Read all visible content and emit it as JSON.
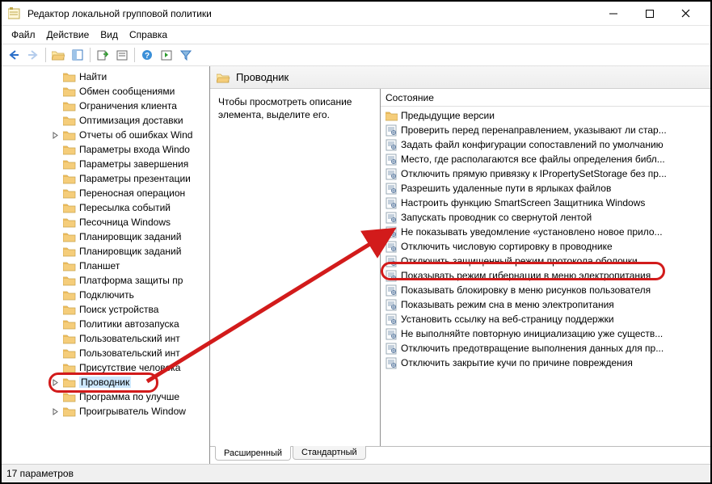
{
  "window": {
    "title": "Редактор локальной групповой политики"
  },
  "menu": {
    "file": "Файл",
    "action": "Действие",
    "view": "Вид",
    "help": "Справка"
  },
  "tree": {
    "items": [
      {
        "label": "Найти",
        "expand": ""
      },
      {
        "label": "Обмен сообщениями",
        "expand": ""
      },
      {
        "label": "Ограничения клиента",
        "expand": ""
      },
      {
        "label": "Оптимизация доставки",
        "expand": ""
      },
      {
        "label": "Отчеты об ошибках Wind",
        "expand": ">"
      },
      {
        "label": "Параметры входа Windo",
        "expand": ""
      },
      {
        "label": "Параметры завершения",
        "expand": ""
      },
      {
        "label": "Параметры презентации",
        "expand": ""
      },
      {
        "label": "Переносная операцион",
        "expand": ""
      },
      {
        "label": "Пересылка событий",
        "expand": ""
      },
      {
        "label": "Песочница Windows",
        "expand": ""
      },
      {
        "label": "Планировщик заданий",
        "expand": ""
      },
      {
        "label": "Планировщик заданий",
        "expand": ""
      },
      {
        "label": "Планшет",
        "expand": ""
      },
      {
        "label": "Платформа защиты пр",
        "expand": ""
      },
      {
        "label": "Подключить",
        "expand": ""
      },
      {
        "label": "Поиск устройства",
        "expand": ""
      },
      {
        "label": "Политики автозапуска",
        "expand": ""
      },
      {
        "label": "Пользовательский инт",
        "expand": ""
      },
      {
        "label": "Пользовательский инт",
        "expand": ""
      },
      {
        "label": "Присутствие человека",
        "expand": ""
      },
      {
        "label": "Проводник",
        "expand": ">",
        "highlight": true
      },
      {
        "label": "Программа по улучше",
        "expand": ""
      },
      {
        "label": "Проигрыватель Window",
        "expand": ">"
      }
    ]
  },
  "content": {
    "header": "Проводник",
    "desc": "Чтобы просмотреть описание элемента, выделите его.",
    "list_header": "Состояние",
    "items": [
      {
        "type": "folder",
        "label": "Предыдущие версии"
      },
      {
        "type": "setting",
        "label": "Проверить перед перенаправлением, указывают ли стар..."
      },
      {
        "type": "setting",
        "label": "Задать файл конфигурации сопоставлений по умолчанию"
      },
      {
        "type": "setting",
        "label": "Место, где располагаются все файлы определения библ..."
      },
      {
        "type": "setting",
        "label": "Отключить прямую привязку к IPropertySetStorage без пр..."
      },
      {
        "type": "setting",
        "label": "Разрешить удаленные пути в ярлыках файлов"
      },
      {
        "type": "setting",
        "label": "Настроить функцию SmartScreen Защитника Windows"
      },
      {
        "type": "setting",
        "label": "Запускать проводник со свернутой лентой"
      },
      {
        "type": "setting",
        "label": "Не показывать уведомление «установлено новое прило..."
      },
      {
        "type": "setting",
        "label": "Отключить числовую сортировку в проводнике"
      },
      {
        "type": "setting",
        "label": "Отключить защищенный режим протокола оболочки"
      },
      {
        "type": "setting",
        "label": "Показывать режим гибернации в меню электропитания",
        "highlight": true
      },
      {
        "type": "setting",
        "label": "Показывать блокировку в меню рисунков пользователя"
      },
      {
        "type": "setting",
        "label": "Показывать режим сна в меню электропитания"
      },
      {
        "type": "setting",
        "label": "Установить ссылку на веб-страницу поддержки"
      },
      {
        "type": "setting",
        "label": "Не выполняйте повторную инициализацию уже существ..."
      },
      {
        "type": "setting",
        "label": "Отключить предотвращение выполнения данных для пр..."
      },
      {
        "type": "setting",
        "label": "Отключить закрытие кучи по причине повреждения"
      }
    ]
  },
  "tabs": {
    "extended": "Расширенный",
    "standard": "Стандартный"
  },
  "status": "17 параметров"
}
